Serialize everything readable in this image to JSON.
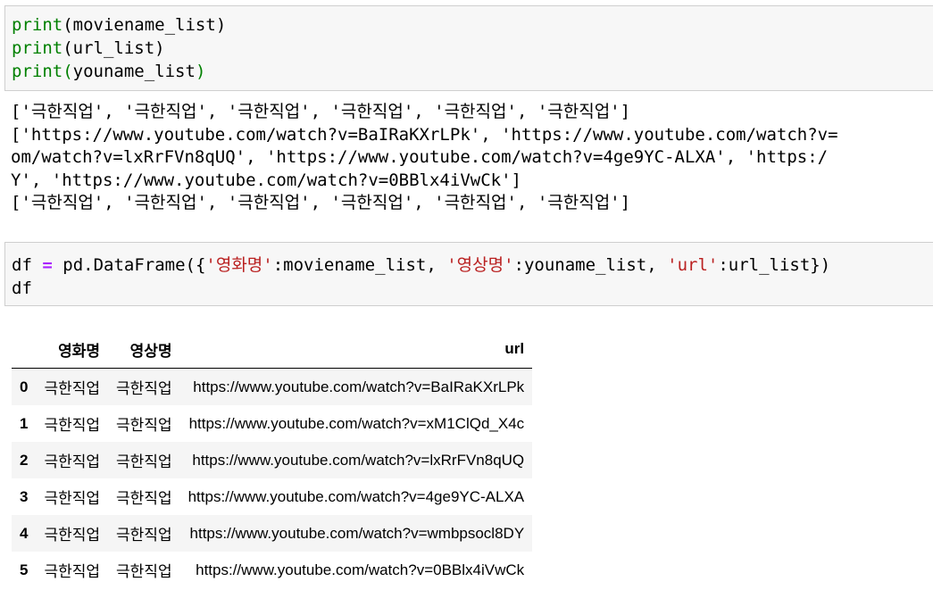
{
  "cell1": {
    "lines": [
      {
        "fn": "print",
        "arg": "moviename_list"
      },
      {
        "fn": "print",
        "arg": "url_list"
      },
      {
        "fn": "print",
        "arg": "youname_list"
      }
    ]
  },
  "output1": {
    "lines": [
      "['극한직업', '극한직업', '극한직업', '극한직업', '극한직업', '극한직업']",
      "['https://www.youtube.com/watch?v=BaIRaKXrLPk', 'https://www.youtube.com/watch?v=",
      "om/watch?v=lxRrFVn8qUQ', 'https://www.youtube.com/watch?v=4ge9YC-ALXA', 'https:/",
      "Y', 'https://www.youtube.com/watch?v=0BBlx4iVwCk']",
      "['극한직업', '극한직업', '극한직업', '극한직업', '극한직업', '극한직업']"
    ]
  },
  "cell2": {
    "line1": {
      "var": "df",
      "op": "=",
      "call": "pd.DataFrame({",
      "key1": "'영화명'",
      "val1": ":moviename_list, ",
      "key2": "'영상명'",
      "val2": ":youname_list, ",
      "key3": "'url'",
      "val3": ":url_list})"
    },
    "line2": "df"
  },
  "dataframe": {
    "columns": [
      "영화명",
      "영상명",
      "url"
    ],
    "rows": [
      {
        "index": "0",
        "movie": "극한직업",
        "video": "극한직업",
        "url": "https://www.youtube.com/watch?v=BaIRaKXrLPk"
      },
      {
        "index": "1",
        "movie": "극한직업",
        "video": "극한직업",
        "url": "https://www.youtube.com/watch?v=xM1ClQd_X4c"
      },
      {
        "index": "2",
        "movie": "극한직업",
        "video": "극한직업",
        "url": "https://www.youtube.com/watch?v=lxRrFVn8qUQ"
      },
      {
        "index": "3",
        "movie": "극한직업",
        "video": "극한직업",
        "url": "https://www.youtube.com/watch?v=4ge9YC-ALXA"
      },
      {
        "index": "4",
        "movie": "극한직업",
        "video": "극한직업",
        "url": "https://www.youtube.com/watch?v=wmbpsocl8DY"
      },
      {
        "index": "5",
        "movie": "극한직업",
        "video": "극한직업",
        "url": "https://www.youtube.com/watch?v=0BBlx4iVwCk"
      }
    ]
  }
}
